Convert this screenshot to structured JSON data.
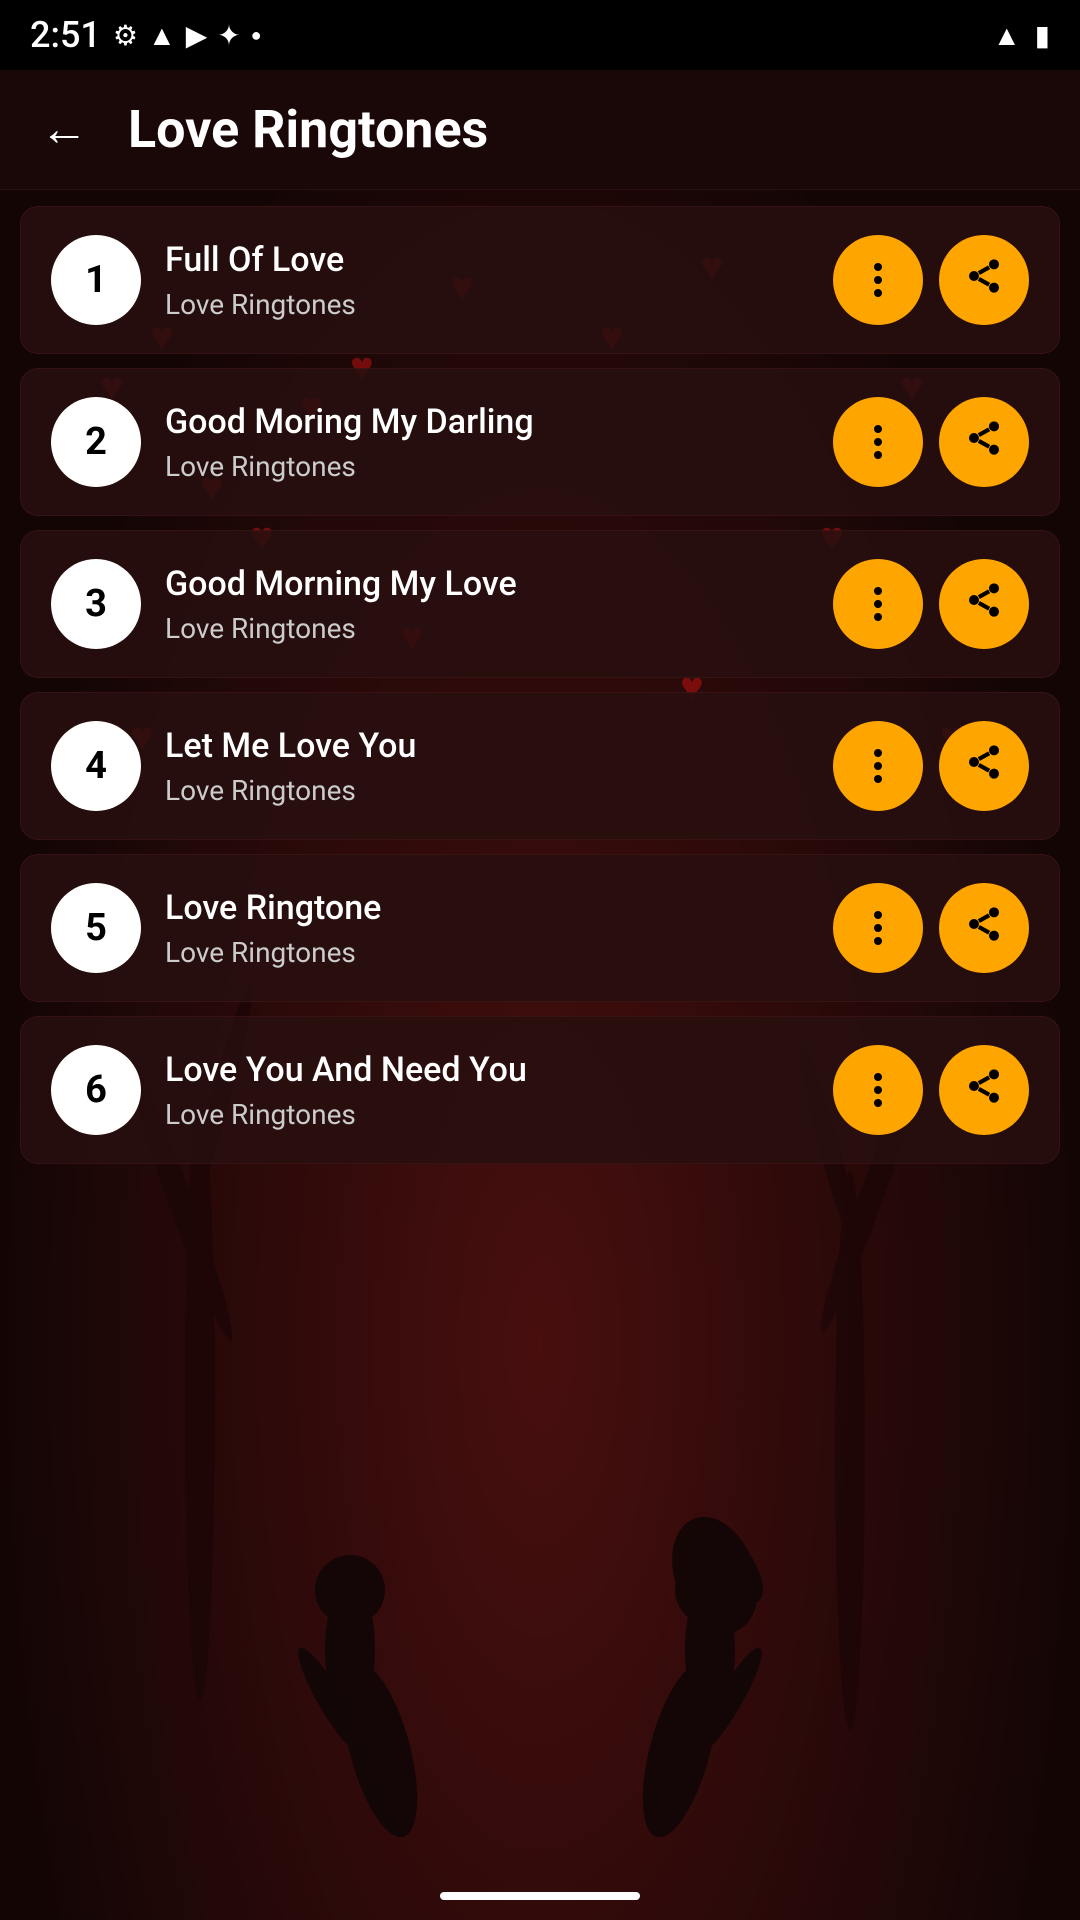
{
  "statusBar": {
    "time": "2:51",
    "icons": [
      "gear",
      "clipboard",
      "shield",
      "music-note",
      "dot"
    ]
  },
  "header": {
    "backLabel": "←",
    "title": "Love Ringtones"
  },
  "tracks": [
    {
      "number": 1,
      "name": "Full Of Love",
      "category": "Love Ringtones"
    },
    {
      "number": 2,
      "name": "Good Moring My Darling",
      "category": "Love Ringtones"
    },
    {
      "number": 3,
      "name": "Good Morning My Love",
      "category": "Love Ringtones"
    },
    {
      "number": 4,
      "name": "Let Me Love You",
      "category": "Love Ringtones"
    },
    {
      "number": 5,
      "name": "Love Ringtone",
      "category": "Love Ringtones"
    },
    {
      "number": 6,
      "name": "Love You And Need You",
      "category": "Love Ringtones"
    }
  ],
  "bottomIndicator": "",
  "colors": {
    "accent": "#FFA500",
    "background": "#1a0a0a",
    "cardBg": "rgba(40,15,15,0.85)",
    "white": "#ffffff",
    "black": "#000000"
  }
}
